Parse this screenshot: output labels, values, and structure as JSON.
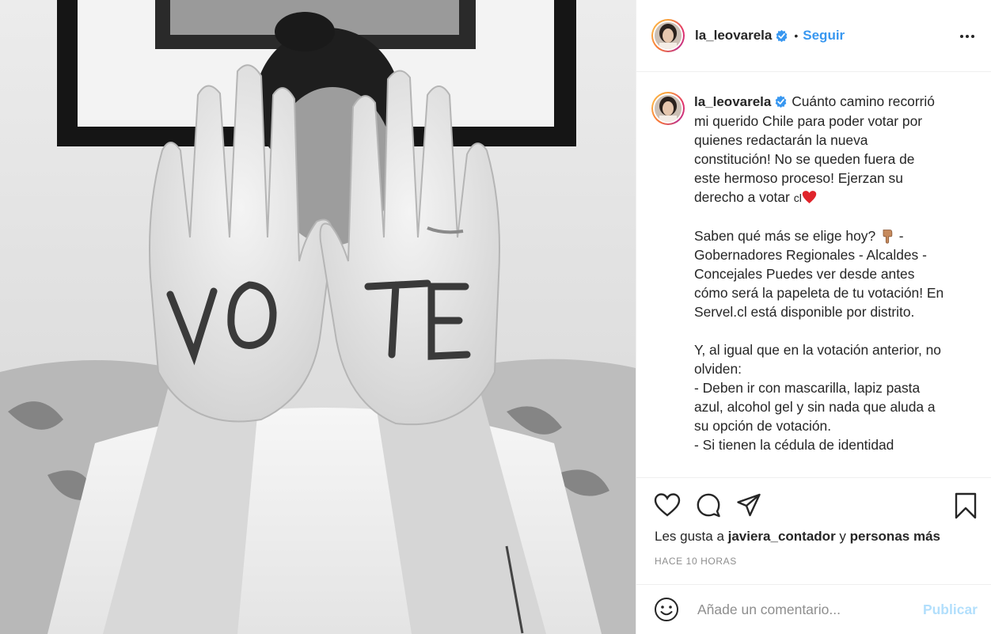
{
  "photo": {
    "alt_text_letters": [
      "V",
      "O",
      "T",
      "E"
    ],
    "tone": "black-and-white"
  },
  "header": {
    "username": "la_leovarela",
    "verified_icon": "verified-badge-icon",
    "separator": "•",
    "follow_label": "Seguir",
    "more_icon": "more-options-icon"
  },
  "caption": {
    "username": "la_leovarela",
    "paragraph_1": " Cuánto camino recorrió mi querido Chile para poder votar por quienes redactarán la nueva constitución! No se queden fuera de este hermoso proceso! Ejerzan su derecho a votar ",
    "flag_text": "cl",
    "heart_emoji": "red-heart-emoji",
    "paragraph_2_a": "Saben qué más se elige hoy? ",
    "hand_emoji": "backhand-index-pointing-down-emoji",
    "paragraph_2_b": " - Gobernadores Regionales - Alcaldes - Concejales Puedes ver desde antes cómo será la papeleta de tu votación! En Servel.cl está disponible por distrito.",
    "paragraph_3": "Y, al igual que en la votación anterior, no olviden:\n- Deben ir con mascarilla, lapiz pasta azul, alcohol gel y sin nada que aluda a su opción de votación.\n- Si tienen la cédula de identidad"
  },
  "actions": {
    "like_icon": "heart-icon",
    "comment_icon": "comment-icon",
    "share_icon": "share-icon",
    "save_icon": "bookmark-icon",
    "likes_prefix": "Les gusta a ",
    "likes_user": "javiera_contador",
    "likes_mid": " y ",
    "likes_suffix": "personas más",
    "timestamp": "HACE 10 HORAS"
  },
  "comment": {
    "emoji_icon": "smiley-icon",
    "placeholder": "Añade un comentario...",
    "publish_label": "Publicar"
  },
  "colors": {
    "link": "#3897f0",
    "publish_disabled": "#b2dffc",
    "muted": "#8e8e8e",
    "border": "#efefef"
  }
}
